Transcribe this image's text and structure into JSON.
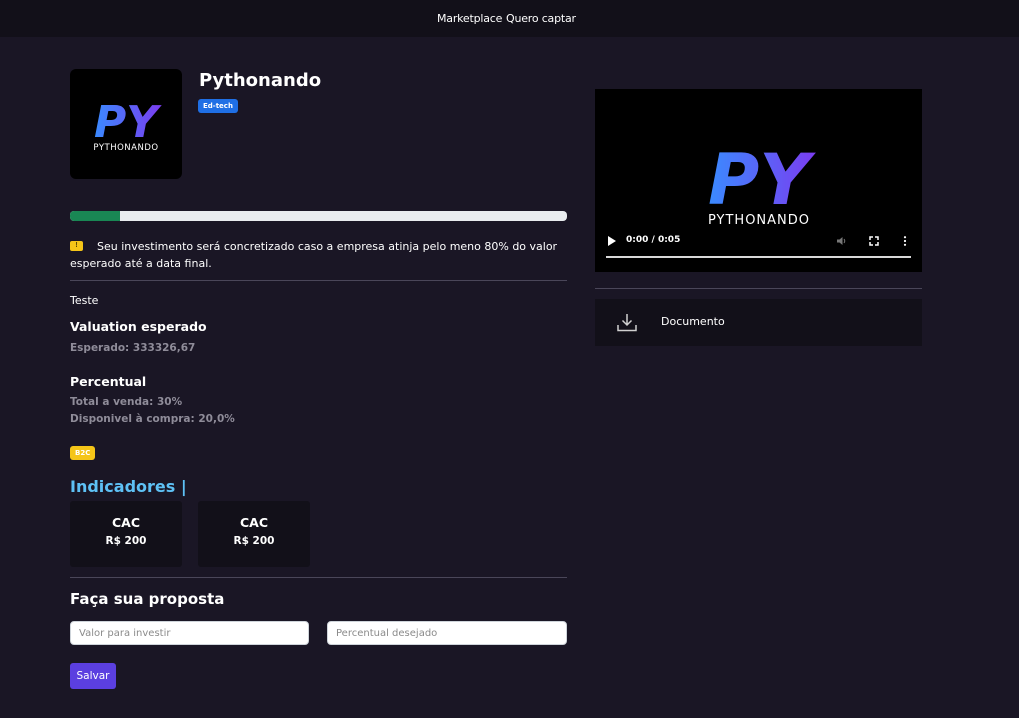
{
  "nav": {
    "links": [
      "Marketplace",
      "Quero captar"
    ]
  },
  "company": {
    "name": "Pythonando",
    "tag": "Ed-tech",
    "logo_text": "PYTHONANDO",
    "logo_mark": "PY"
  },
  "progress": {
    "value_percent": 10,
    "color": "#198754"
  },
  "notice": {
    "icon": "warning-icon",
    "text": "Seu investimento será concretizado caso a empresa atinja pelo meno 80% do valor esperado até a data final."
  },
  "description": "Teste",
  "valuation": {
    "title": "Valuation esperado",
    "expected": "Esperado: 333326,67"
  },
  "percentual": {
    "title": "Percentual",
    "total_sale": "Total a venda: 30%",
    "available": "Disponivel à compra: 20,0%"
  },
  "market_badge": "B2C",
  "indicators": {
    "title": "Indicadores |",
    "items": [
      {
        "name": "CAC",
        "value": "R$ 200"
      },
      {
        "name": "CAC",
        "value": "R$ 200"
      }
    ]
  },
  "proposal": {
    "title": "Faça sua proposta",
    "invest_placeholder": "Valor para investir",
    "percent_placeholder": "Percentual desejado",
    "save_label": "Salvar"
  },
  "video": {
    "time": "0:00 / 0:05",
    "progress_percent": 0,
    "logo_text": "PYTHONANDO"
  },
  "document": {
    "label": "Documento",
    "icon": "download-icon"
  },
  "colors": {
    "background": "#1a1625",
    "topbar": "#121019",
    "tag_blue": "#1f6fe5",
    "badge_yellow": "#f5c518",
    "indicator_title": "#5ec1f5",
    "button": "#5b3fe0"
  }
}
